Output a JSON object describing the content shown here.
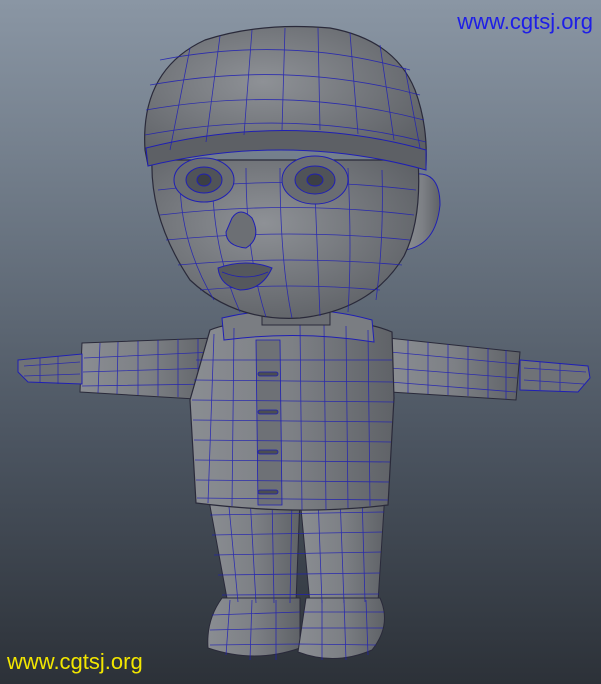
{
  "viewport": {
    "watermark_top": "www.cgtsj.org",
    "watermark_bottom": "www.cgtsj.org"
  },
  "model": {
    "subject": "stylized boy character wireframe mesh, T-pose",
    "mesh_fill": "#7c7f84",
    "mesh_shade": "#5a5d62",
    "wire_color": "#1f1fb4"
  },
  "colors": {
    "watermark_top": "#1e1ee6",
    "watermark_bottom": "#f2e600",
    "background_top": "#8a96a4",
    "background_bottom": "#2c3138"
  }
}
